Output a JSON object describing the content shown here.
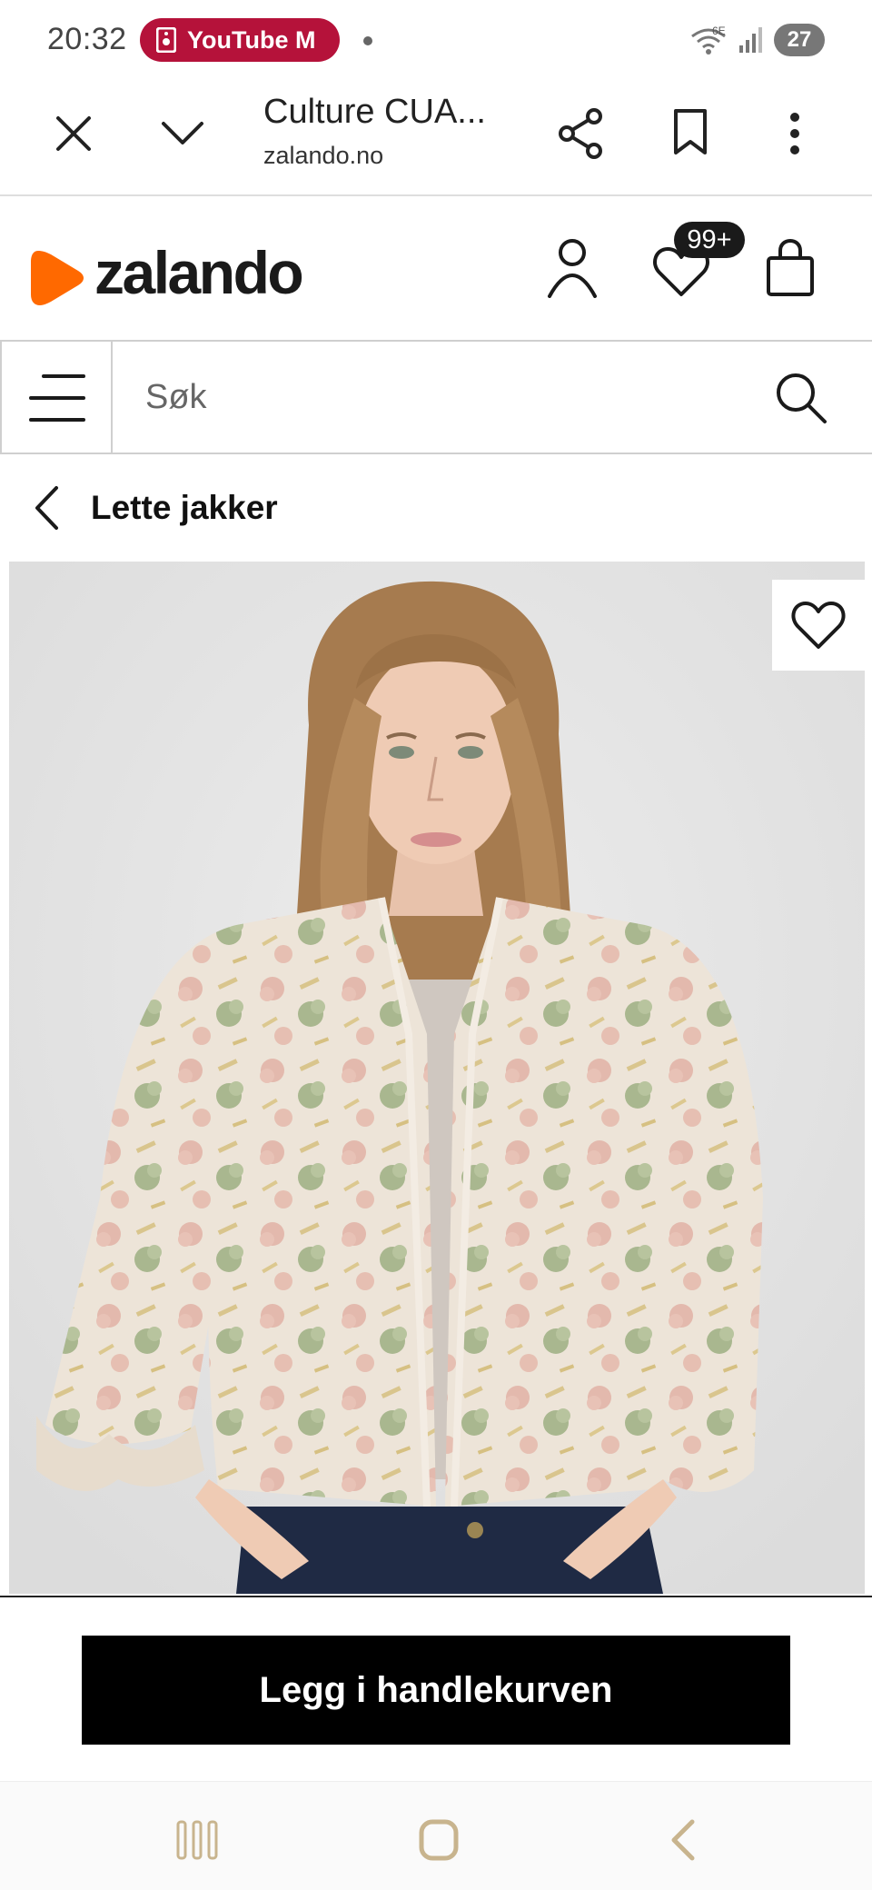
{
  "status_bar": {
    "time": "20:32",
    "notification_app": "YouTube M",
    "network": "6E",
    "battery": "27"
  },
  "browser": {
    "page_title": "Culture CUA...",
    "domain": "zalando.no",
    "close_icon": "close-icon",
    "tabs_icon": "chevron-down-icon",
    "share_icon": "share-icon",
    "bookmark_icon": "bookmark-icon",
    "more_icon": "more-vert-icon"
  },
  "site_header": {
    "logo_text": "zalando",
    "brand_color": "#ff6900",
    "wishlist_count": "99+"
  },
  "search": {
    "placeholder": "Søk"
  },
  "breadcrumb": {
    "label": "Lette jakker"
  },
  "product": {
    "image_background": "#e4e4e4",
    "jacket_base_color": "#ece3d6"
  },
  "cart": {
    "button_label": "Legg i handlekurven"
  }
}
